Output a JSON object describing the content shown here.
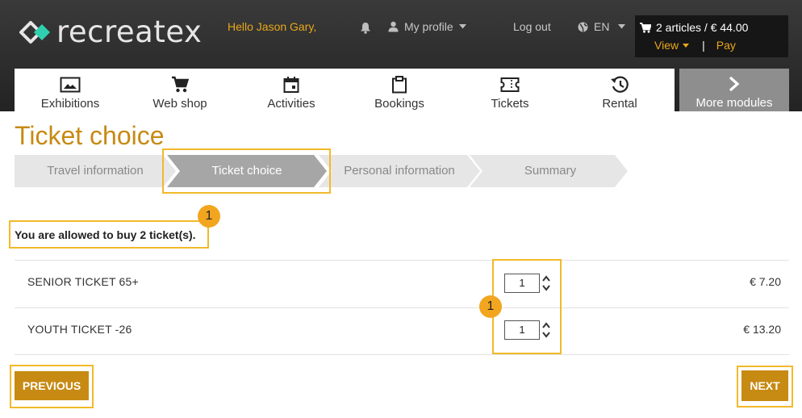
{
  "header": {
    "logo_text": "recreatex",
    "greeting": "Hello Jason Gary,",
    "profile_label": "My profile",
    "logout_label": "Log out",
    "language": "EN",
    "cart_summary": "2 articles / € 44.00",
    "cart_view": "View",
    "cart_separator": "|",
    "cart_pay": "Pay"
  },
  "nav": {
    "items": [
      {
        "label": "Exhibitions",
        "icon": "image-icon"
      },
      {
        "label": "Web shop",
        "icon": "cart-icon"
      },
      {
        "label": "Activities",
        "icon": "calendar-icon"
      },
      {
        "label": "Bookings",
        "icon": "clipboard-icon"
      },
      {
        "label": "Tickets",
        "icon": "ticket-icon"
      },
      {
        "label": "Rental",
        "icon": "history-icon"
      }
    ],
    "more_label": "More modules"
  },
  "page": {
    "title": "Ticket choice",
    "steps": [
      {
        "label": "Travel information",
        "active": false
      },
      {
        "label": "Ticket choice",
        "active": true
      },
      {
        "label": "Personal information",
        "active": false
      },
      {
        "label": "Summary",
        "active": false
      }
    ],
    "allowed_text": "You are allowed to buy 2 ticket(s).",
    "badge_number": "1",
    "tickets": [
      {
        "name": "SENIOR TICKET 65+",
        "quantity": "1",
        "price": "€ 7.20"
      },
      {
        "name": "YOUTH TICKET -26",
        "quantity": "1",
        "price": "€ 13.20"
      }
    ],
    "previous_label": "PREVIOUS",
    "next_label": "NEXT"
  },
  "colors": {
    "accent": "#c78a13",
    "highlight": "#f2b92a",
    "badge": "#f2a51f",
    "header_bg": "#2b2b2b",
    "step_active": "#a6a6a6",
    "step_inactive": "#e6e6e6"
  }
}
